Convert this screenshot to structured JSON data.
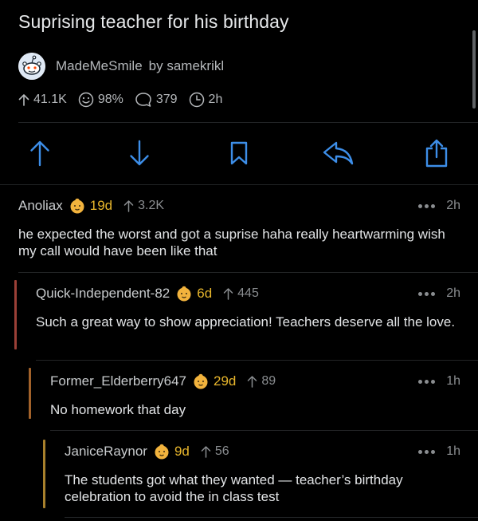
{
  "post": {
    "title": "Suprising teacher for his birthday",
    "subreddit": "MadeMeSmile",
    "byline": "by samekrikl",
    "upvotes": "41.1K",
    "ratio": "98%",
    "comments": "379",
    "age": "2h"
  },
  "actions": [
    {
      "name": "upvote",
      "icon": "arrow-up-icon"
    },
    {
      "name": "downvote",
      "icon": "arrow-down-icon"
    },
    {
      "name": "save",
      "icon": "bookmark-icon"
    },
    {
      "name": "reply",
      "icon": "reply-icon"
    },
    {
      "name": "share",
      "icon": "share-icon"
    }
  ],
  "colors": {
    "accent": "#3d8ee8",
    "age_badge": "#e8b62c",
    "thread_1": "#9b4037",
    "thread_2": "#a2622a",
    "thread_3": "#a8802c"
  },
  "comments": [
    {
      "user": "Anoliax",
      "age": "19d",
      "votes": "3.2K",
      "time": "2h",
      "text": "he expected the worst and got a suprise haha really heartwarming wish my call would have been like that"
    },
    {
      "user": "Quick-Independent-82",
      "age": "6d",
      "votes": "445",
      "time": "2h",
      "text": "Such a great way to show appreciation! Teachers deserve all the love."
    },
    {
      "user": "Former_Elderberry647",
      "age": "29d",
      "votes": "89",
      "time": "1h",
      "text": "No homework that day"
    },
    {
      "user": "JaniceRaynor",
      "age": "9d",
      "votes": "56",
      "time": "1h",
      "text": "The students got what they wanted — teacher’s birthday celebration to avoid the in class test"
    }
  ]
}
